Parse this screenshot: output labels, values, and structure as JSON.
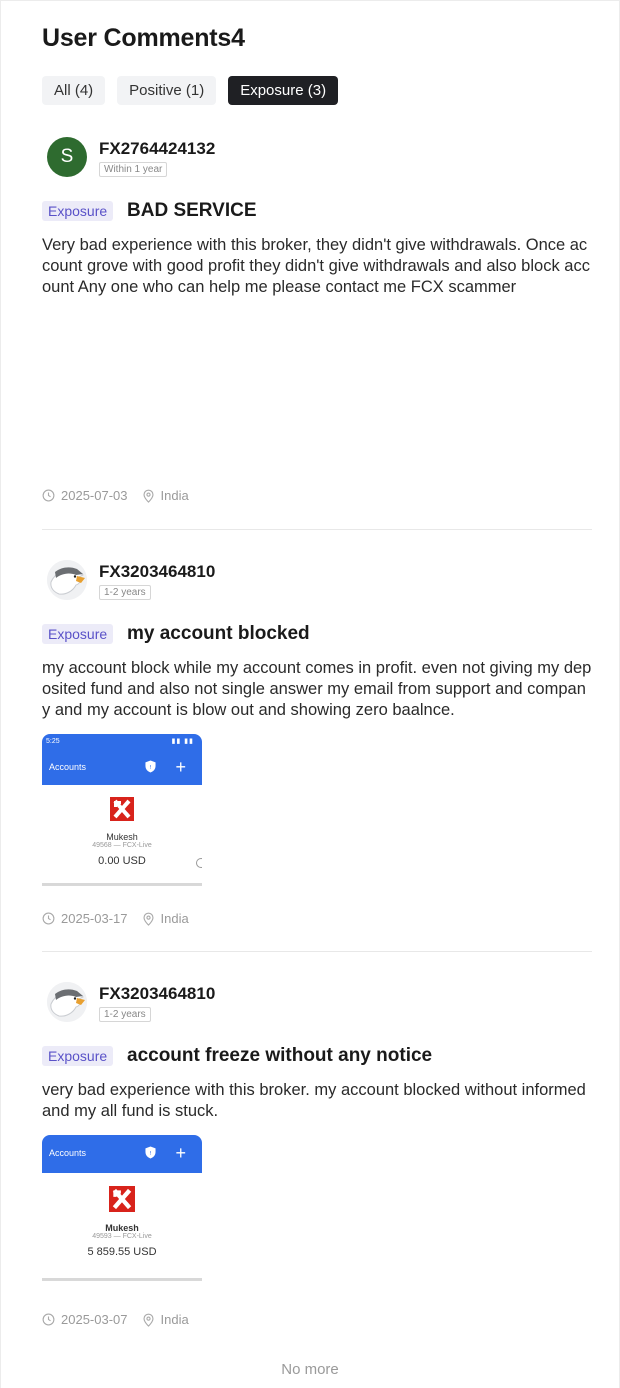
{
  "page": {
    "title": "User Comments4"
  },
  "tabs": [
    {
      "label": "All (4)",
      "active": false
    },
    {
      "label": "Positive (1)",
      "active": false
    },
    {
      "label": "Exposure (3)",
      "active": true
    }
  ],
  "comments": [
    {
      "avatar_letter": "S",
      "avatar_type": "letter",
      "user": "FX2764424132",
      "tenure": "Within 1 year",
      "tag": "Exposure",
      "title": "BAD SERVICE",
      "text": "Very bad experience with this broker, they didn't give withdrawals. Once account grove with good profit they didn't give withdrawals and also block account Any one who can help me please contact me FCX scammer",
      "date": "2025-07-03",
      "location": "India"
    },
    {
      "avatar_type": "eagle",
      "user": "FX3203464810",
      "tenure": "1-2 years",
      "tag": "Exposure",
      "title": "my account blocked",
      "text": "my account block while my account comes in profit. even not giving my deposited fund and also not single answer my email from support and company and my account is blow out and showing zero baalnce.",
      "screenshot": {
        "status_time": "5:25",
        "header": "Accounts",
        "name": "Mukesh",
        "account": "49568 — FCX-Live",
        "balance": "0.00 USD"
      },
      "date": "2025-03-17",
      "location": "India"
    },
    {
      "avatar_type": "eagle",
      "user": "FX3203464810",
      "tenure": "1-2 years",
      "tag": "Exposure",
      "title": "account freeze without any notice",
      "text": "very bad experience with this broker. my account blocked without informed and my all fund is stuck.",
      "screenshot": {
        "header": "Accounts",
        "name": "Mukesh",
        "account": "49593 — FCX-Live",
        "balance": "5 859.55 USD"
      },
      "date": "2025-03-07",
      "location": "India"
    }
  ],
  "footer": {
    "no_more": "No more"
  },
  "colors": {
    "tag_bg": "#ecebf8",
    "tag_text": "#5a52c8",
    "active_tab": "#1f2024",
    "app_blue": "#2f6de8",
    "avatar_green": "#2e6b2f"
  }
}
